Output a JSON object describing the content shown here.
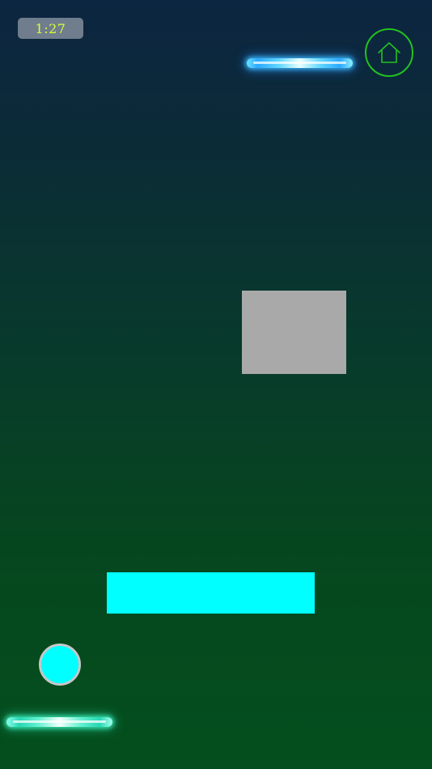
{
  "hud": {
    "timer": "1:27"
  },
  "icons": {
    "home": "home-icon"
  },
  "colors": {
    "background_top": "#0c2541",
    "background_bottom": "#044f1d",
    "timer_text": "#d9ff3c",
    "home_ring": "#22c21f",
    "obstacle": "#a9a9a9",
    "platform": "#00ffff",
    "ball": "#00ffff",
    "laser_top": "#2ba9ff",
    "laser_bottom": "#27d7b4"
  }
}
